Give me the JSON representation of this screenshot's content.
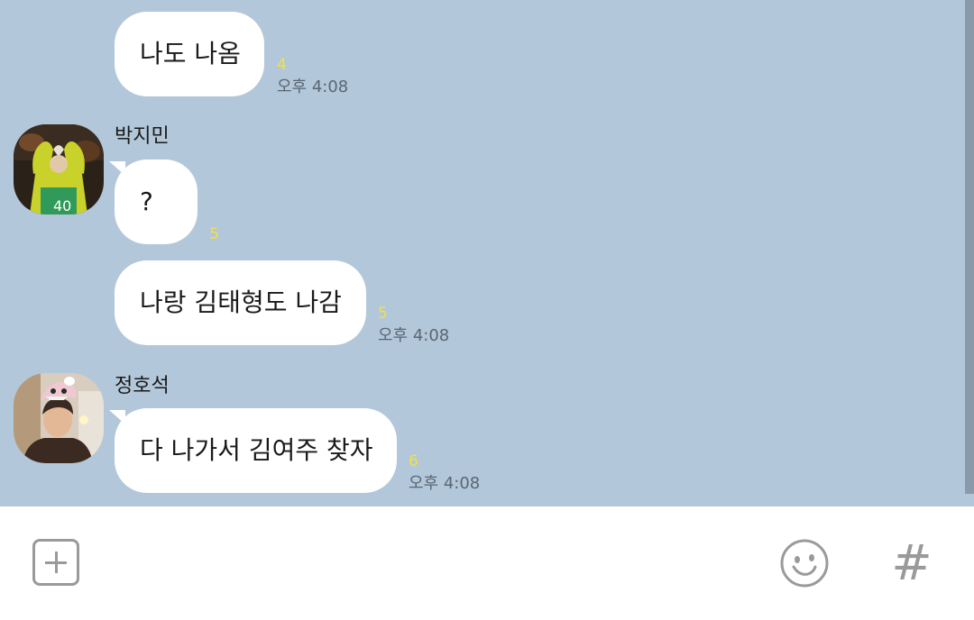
{
  "messages": [
    {
      "text": "나도 나옴",
      "unread": "4",
      "time": "오후 4:08"
    },
    {
      "sender": "박지민",
      "text": "?",
      "unread": "5"
    },
    {
      "text": "나랑 김태형도 나감",
      "unread": "5",
      "time": "오후 4:08"
    },
    {
      "sender": "정호석",
      "text": "다 나가서 김여주 찾자",
      "unread": "6",
      "time": "오후 4:08"
    }
  ],
  "input_bar": {
    "attach_icon": "plus-square-icon",
    "emoji_icon": "smiley-icon",
    "hash_label": "#"
  },
  "colors": {
    "chat_background": "#b2c7da",
    "bubble": "#ffffff",
    "unread": "#f5e13a"
  }
}
